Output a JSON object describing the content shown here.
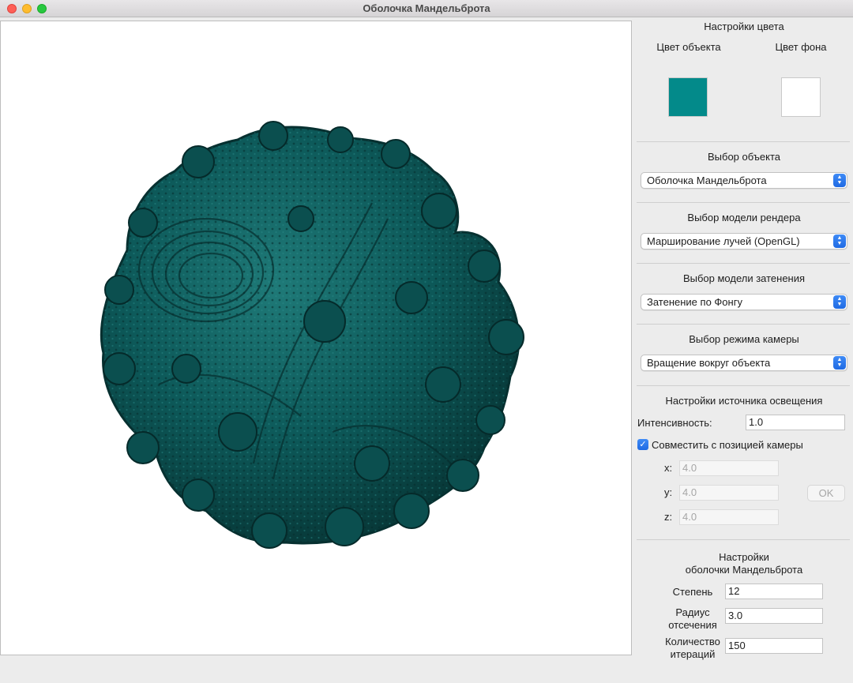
{
  "window": {
    "title": "Оболочка Мандельброта"
  },
  "color_settings": {
    "title": "Настройки цвета",
    "object_color_label": "Цвет объекта",
    "background_color_label": "Цвет фона",
    "object_color": "#038a8a",
    "background_color": "#ffffff"
  },
  "object_select": {
    "title": "Выбор объекта",
    "value": "Оболочка Мандельброта"
  },
  "render_select": {
    "title": "Выбор модели рендера",
    "value": "Марширование лучей (OpenGL)"
  },
  "shading_select": {
    "title": "Выбор модели затенения",
    "value": "Затенение по Фонгу"
  },
  "camera_select": {
    "title": "Выбор режима камеры",
    "value": "Вращение вокруг объекта"
  },
  "light": {
    "title": "Настройки источника освещения",
    "intensity_label": "Интенсивность:",
    "intensity_value": "1.0",
    "match_camera_label": "Совместить с позицией камеры",
    "match_camera_checked": true,
    "x_label": "x:",
    "x_value": "4.0",
    "y_label": "y:",
    "y_value": "4.0",
    "z_label": "z:",
    "z_value": "4.0",
    "ok_label": "OK"
  },
  "mandelbulb": {
    "title_line1": "Настройки",
    "title_line2": "оболочки Мандельброта",
    "power_label": "Степень",
    "power_value": "12",
    "radius_label_line1": "Радиус",
    "radius_label_line2": "отсечения",
    "radius_value": "3.0",
    "iterations_label_line1": "Количество",
    "iterations_label_line2": "итераций",
    "iterations_value": "150"
  },
  "render_colors": {
    "fractal_base": "#0d5a5a",
    "fractal_dark": "#083c3c",
    "fractal_light": "#1f7a78"
  }
}
